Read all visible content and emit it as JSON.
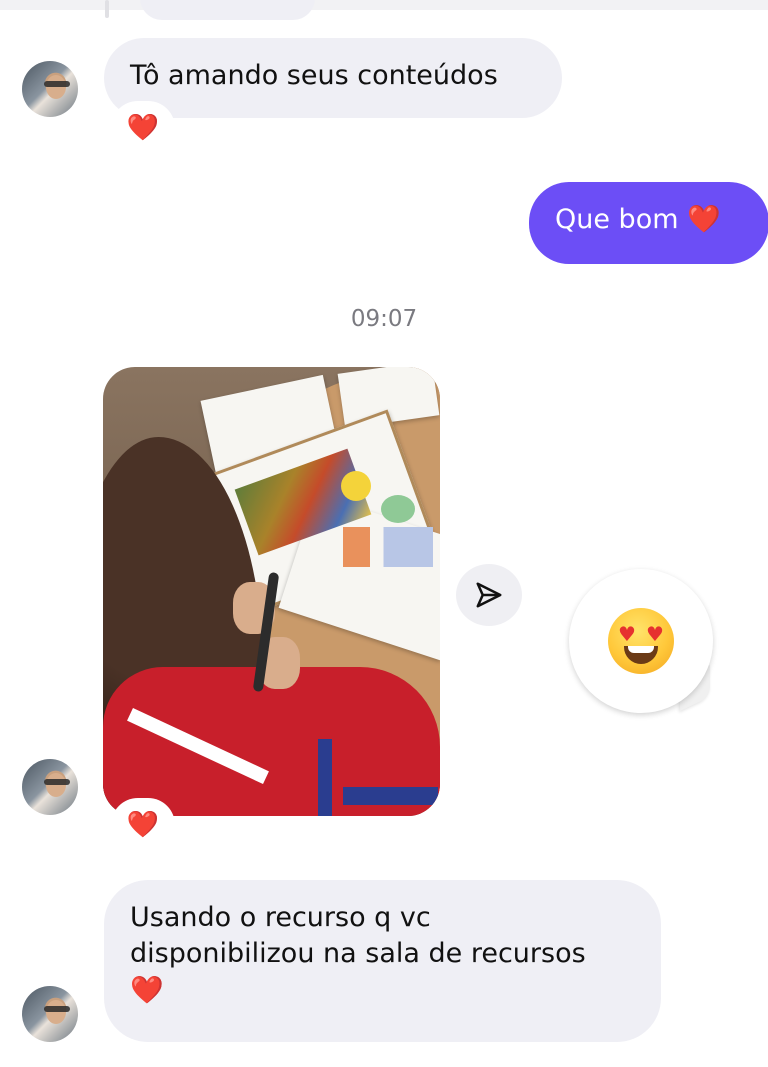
{
  "conversation": {
    "messages": [
      {
        "id": "m1",
        "side": "received",
        "text": "Tô amando seus conteúdos",
        "reaction": "❤️"
      },
      {
        "id": "m2",
        "side": "sent",
        "text": "Que bom ❤️"
      },
      {
        "id": "m3",
        "side": "received",
        "type": "photo",
        "reaction": "❤️"
      },
      {
        "id": "m4",
        "side": "sent",
        "type": "sticker",
        "sticker": "😍"
      },
      {
        "id": "m5",
        "side": "received",
        "text_lines": [
          "Usando o recurso q vc",
          "disponibilizou na sala de recursos",
          "❤️"
        ]
      }
    ],
    "timestamp": "09:07"
  },
  "icons": {
    "share": "send-paper-plane-icon",
    "heart": "red-heart-icon",
    "sticker": "heart-eyes-emoji-icon",
    "avatar": "contact-avatar"
  },
  "colors": {
    "sent_bubble": "#6c4ef6",
    "received_bubble": "#efeff5",
    "heart": "#e6312f"
  }
}
